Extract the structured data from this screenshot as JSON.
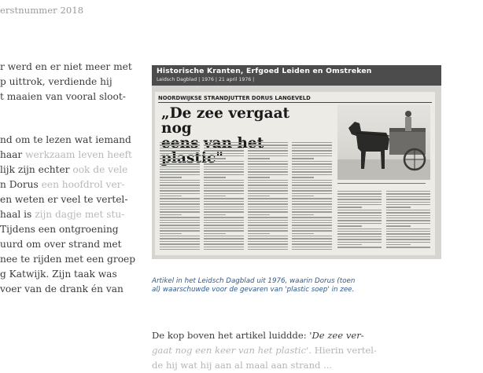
{
  "header": {
    "issue_label": "erstnummer 2018"
  },
  "left_column": {
    "block1": [
      {
        "a": "r werd en er niet meer met",
        "b": ""
      },
      {
        "a": "p uittrok, verdiende hij",
        "b": ""
      },
      {
        "a": "t maaien van vooral sloot-",
        "b": ""
      }
    ],
    "block2": [
      {
        "a": "nd om te lezen wat iemand",
        "b": ""
      },
      {
        "a": "haar ",
        "b": "werkzaam leven heeft"
      },
      {
        "a": "lijk zijn echter ",
        "b": "ook de vele"
      },
      {
        "a": "n Dorus ",
        "b": "een hoofdrol ver-"
      },
      {
        "a": "en weten er veel te vertel-",
        "b": ""
      },
      {
        "a": "haal is ",
        "b": "zijn dagje met stu-"
      },
      {
        "a": " Tijdens een ontgroening",
        "b": ""
      },
      {
        "a": "uurd om over strand met",
        "b": ""
      },
      {
        "a": "nee te rijden met een groep",
        "b": ""
      },
      {
        "a": "g Katwijk. Zijn taak was",
        "b": ""
      },
      {
        "a": "voer van de drank én van",
        "b": ""
      }
    ]
  },
  "clipping": {
    "title": "Historische Kranten, Erfgoed Leiden en Omstreken",
    "meta": "Leidsch Dagblad | 1976 | 21 april 1976 |",
    "strap": "NOORDWIJKSE STRANDJUTTER DORUS LANGEVELD",
    "headline_line1": "„De zee vergaat nog",
    "headline_line2": "eens van het plastic\""
  },
  "caption": {
    "line1": "Artikel in het Leidsch Dagblad uit 1976, waarin Dorus (toen",
    "line2": "al) waarschuwde voor de gevaren van 'plastic soep' in zee."
  },
  "right_column": {
    "line1_a": "De kop boven het artikel luiddde: ",
    "line1_b": "'De zee ver-",
    "line2_a": "gaat nog een keer van het plastic'. ",
    "line2_b": "Hierin vertel-",
    "line3_a": "de hij wat hij aan al ",
    "line3_b": "maal aan strand ..."
  },
  "colors": {
    "caption": "#2e5a8e",
    "clip_bar": "#4c4c4c"
  }
}
